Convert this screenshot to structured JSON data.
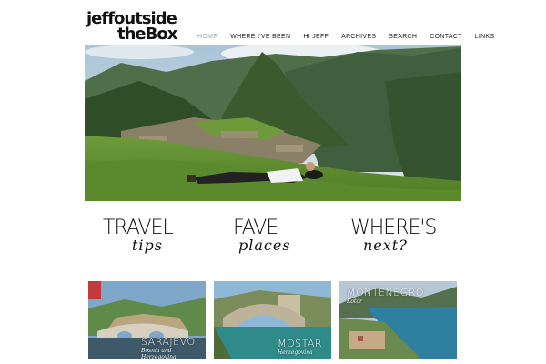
{
  "logo": {
    "line1": "jeffoutside",
    "line2": "theBox"
  },
  "nav": {
    "items": [
      "HOME",
      "WHERE I'VE BEEN",
      "HI JEFF",
      "ARCHIVES",
      "SEARCH",
      "CONTACT",
      "LINKS"
    ]
  },
  "promos": [
    {
      "big": "TRAVEL",
      "script": "tips"
    },
    {
      "big": "FAVE",
      "script": "places"
    },
    {
      "big": "WHERE'S",
      "script": "next?"
    }
  ],
  "thumbs": [
    {
      "title": "SARAJEVO",
      "subtitle": "Bosnia and Herzegovina"
    },
    {
      "title": "MOSTAR",
      "subtitle": "Herzegovina"
    },
    {
      "title": "MONTENEGRO",
      "subtitle": "Kotor"
    }
  ]
}
